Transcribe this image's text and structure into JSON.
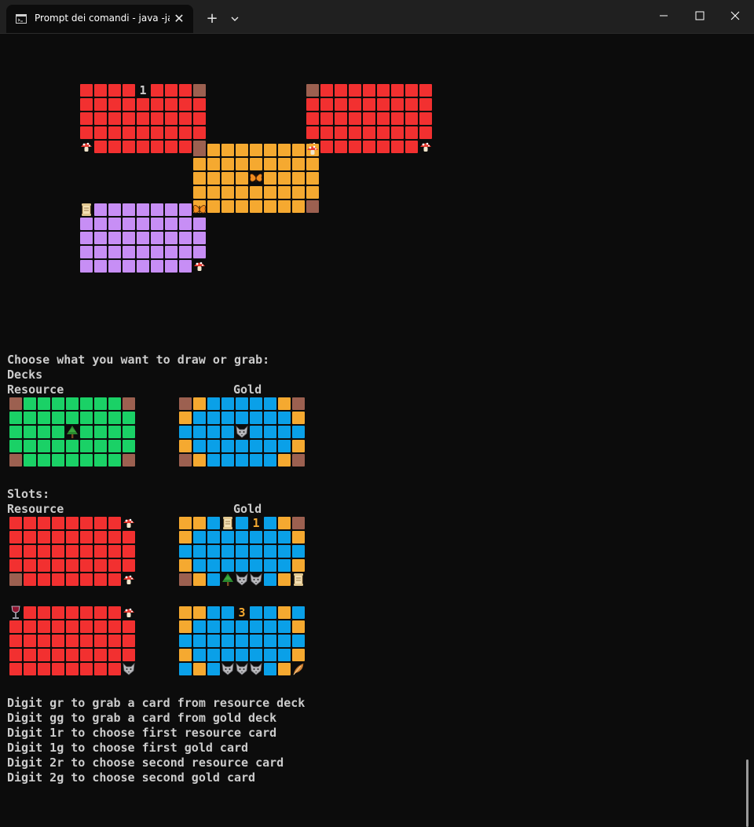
{
  "window": {
    "tab_title": "Prompt dei comandi - java  -ja",
    "tab_icon": "terminal-icon",
    "close_tab_glyph": "✕",
    "new_tab_glyph": "+"
  },
  "colors": {
    "background": "#0c0c0c",
    "text": "#cccccc",
    "red": "#f23030",
    "orange": "#f5a930",
    "purple": "#c78ef5",
    "green": "#1ad166",
    "blue": "#0aa0e8",
    "brown": "#9c6050"
  },
  "board": {
    "cards": [
      {
        "name": "red-card-1",
        "color": "red",
        "label": "1",
        "corners": [
          "red",
          "brown",
          "mushroom-icon",
          "brown"
        ]
      },
      {
        "name": "red-card-2",
        "color": "red",
        "label": "",
        "corners": [
          "brown",
          "red",
          "mushroom-icon",
          "mushroom-icon"
        ]
      },
      {
        "name": "orange-card",
        "color": "orange",
        "center": "butterfly-icon",
        "corners": [
          "brown",
          "mushroom-icon",
          "butterfly-icon",
          "brown"
        ]
      },
      {
        "name": "purple-card",
        "color": "purple",
        "label": "",
        "corners": [
          "scroll-icon",
          "butterfly-icon",
          "purple",
          "mushroom-icon"
        ]
      }
    ]
  },
  "prompt": "Choose what you want to draw or grab:",
  "decks": {
    "heading": "Decks",
    "resource_label": "Resource",
    "gold_label": "Gold",
    "resource_center": "tree-icon",
    "gold_center": "wolf-icon"
  },
  "slots": {
    "heading": "Slots:",
    "resource_label": "Resource",
    "gold_label": "Gold",
    "gold_1_points": "1",
    "gold_2_points": "3",
    "items": [
      {
        "name": "resource-slot-1",
        "icons": [
          "mushroom-icon",
          "mushroom-icon"
        ]
      },
      {
        "name": "gold-slot-1",
        "icons": [
          "scroll-icon",
          "tree-icon",
          "wolf-icon",
          "wolf-icon",
          "scroll-icon"
        ]
      },
      {
        "name": "resource-slot-2",
        "icons": [
          "wine-glass-icon",
          "mushroom-icon",
          "wolf-icon"
        ]
      },
      {
        "name": "gold-slot-2",
        "icons": [
          "wolf-icon",
          "wolf-icon",
          "wolf-icon",
          "feather-icon"
        ]
      }
    ]
  },
  "instructions": [
    "Digit gr to grab a card from resource deck",
    "Digit gg to grab a card from gold deck",
    "Digit 1r to choose first resource card",
    "Digit 1g to choose first gold card",
    "Digit 2r to choose second resource card",
    "Digit 2g to choose second gold card"
  ]
}
